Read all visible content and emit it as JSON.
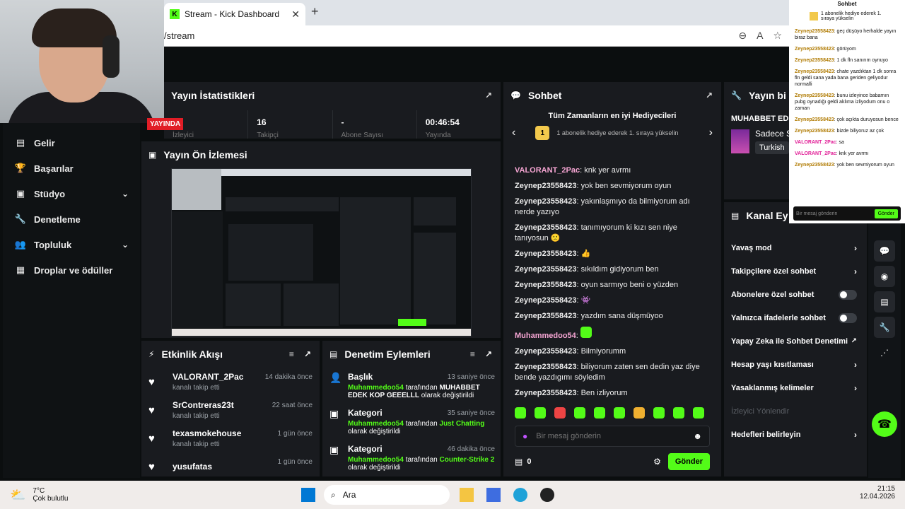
{
  "browser": {
    "tab_title": "Stream - Kick Dashboard",
    "address": "/stream",
    "new_tab": "+"
  },
  "sidebar": {
    "items": [
      {
        "label": "Gelir",
        "icon": "bar-chart-icon"
      },
      {
        "label": "Başarılar",
        "icon": "trophy-icon"
      },
      {
        "label": "Stüdyo",
        "icon": "studio-icon",
        "expand": true
      },
      {
        "label": "Denetleme",
        "icon": "wrench-icon"
      },
      {
        "label": "Topluluk",
        "icon": "users-icon",
        "expand": true
      },
      {
        "label": "Droplar ve ödüller",
        "icon": "gift-icon"
      }
    ]
  },
  "stats": {
    "title": "Yayın İstatistikleri",
    "live_badge": "YAYINDA",
    "cells": [
      {
        "value": "0",
        "label": "İzleyici"
      },
      {
        "value": "16",
        "label": "Takipçi"
      },
      {
        "value": "-",
        "label": "Abone Sayısı"
      },
      {
        "value": "00:46:54",
        "label": "Yayında"
      }
    ]
  },
  "preview": {
    "title": "Yayın Ön İzlemesi"
  },
  "activity": {
    "title": "Etkinlik Akışı",
    "items": [
      {
        "name": "VALORANT_2Pac",
        "sub": "kanalı takip etti",
        "time": "14 dakika önce"
      },
      {
        "name": "SrContreras23t",
        "sub": "kanalı takip etti",
        "time": "22 saat önce"
      },
      {
        "name": "texasmokehouse",
        "sub": "kanalı takip etti",
        "time": "1 gün önce"
      },
      {
        "name": "yusufatas",
        "sub": "",
        "time": "1 gün önce"
      }
    ]
  },
  "moderation": {
    "title": "Denetim Eylemleri",
    "items": [
      {
        "title": "Başlık",
        "time": "13 saniye önce",
        "user": "Muhammedoo54",
        "mid": "tarafından",
        "value": "MUHABBET EDEK KOP GEEELLL",
        "end": "olarak değiştirildi"
      },
      {
        "title": "Kategori",
        "time": "35 saniye önce",
        "user": "Muhammedoo54",
        "mid": "tarafından",
        "value": "Just Chatting",
        "end": "olarak değiştirildi"
      },
      {
        "title": "Kategori",
        "time": "46 dakika önce",
        "user": "Muhammedoo54",
        "mid": "tarafından",
        "value": "Counter-Strike 2",
        "end": "olarak değiştirildi"
      }
    ]
  },
  "chat": {
    "title": "Sohbet",
    "top_title": "Tüm Zamanların en iyi Hediyecileri",
    "top_rank": "1",
    "top_text": "1 abonelik hediye ederek 1. sıraya yükselin",
    "messages": [
      {
        "user": "VALORANT_2Pac",
        "text": "knk yer avrmı",
        "pink": true
      },
      {
        "user": "Zeynep23558423",
        "text": "yok ben sevmiyorum oyun"
      },
      {
        "user": "Zeynep23558423",
        "text": "yakınlaşmıyo da bilmiyorum adı nerde yazıyo"
      },
      {
        "user": "Zeynep23558423",
        "text": "tanımıyorum ki kızı sen niye tanıyosun 🙁"
      },
      {
        "user": "Zeynep23558423",
        "text": "👍"
      },
      {
        "user": "Zeynep23558423",
        "text": "sıkıldım gidiyorum ben"
      },
      {
        "user": "Zeynep23558423",
        "text": "oyun sarmıyo beni o yüzden"
      },
      {
        "user": "Zeynep23558423",
        "text": "👾"
      },
      {
        "user": "Zeynep23558423",
        "text": "yazdım sana düşmüyoo"
      },
      {
        "user": "Muhammedoo54",
        "text": "",
        "pink": true,
        "emote": true
      },
      {
        "user": "Zeynep23558423",
        "text": "Bilmiyorumm"
      },
      {
        "user": "Zeynep23558423",
        "text": "biliyorum zaten sen dedin yaz diye bende yazdıgımı söyledim"
      },
      {
        "user": "Zeynep23558423",
        "text": "Ben izliyorum"
      }
    ],
    "input_placeholder": "Bir mesaj gönderin",
    "count": "0",
    "send": "Gönder"
  },
  "right_info": {
    "title": "Yayın bi",
    "stream_title": "MUHABBET EDEK",
    "channel_name": "Sadece Sc",
    "language": "Turkish"
  },
  "channel": {
    "title": "Kanal Ey",
    "items": [
      {
        "label": "Yavaş mod",
        "type": "chevron"
      },
      {
        "label": "Takipçilere özel sohbet",
        "type": "chevron"
      },
      {
        "label": "Abonelere özel sohbet",
        "type": "toggle"
      },
      {
        "label": "Yalnızca ifadelerle sohbet",
        "type": "toggle"
      },
      {
        "label": "Yapay Zeka ile Sohbet Denetimi",
        "type": "external"
      },
      {
        "label": "Hesap yaşı kısıtlaması",
        "type": "chevron"
      },
      {
        "label": "Yasaklanmış kelimeler",
        "type": "chevron"
      },
      {
        "label": "İzleyici Yönlendir",
        "type": "disabled"
      },
      {
        "label": "Hedefleri belirleyin",
        "type": "chevron"
      }
    ]
  },
  "popout": {
    "title": "Sohbet",
    "top_text": "1 abonelik hediye ederek 1. sıraya yükselin",
    "messages": [
      {
        "user": "Zeynep23558423",
        "text": "geç düşüyo herhalde yayın biraz bana"
      },
      {
        "user": "Zeynep23558423",
        "text": "görüyom"
      },
      {
        "user": "Zeynep23558423",
        "text": "1 dk fln sanırım oynuyo"
      },
      {
        "user": "Zeynep23558423",
        "text": "chate yazdıktan 1 dk sonra fln geldi sana yada bana geriden geliyodur normalli"
      },
      {
        "user": "Zeynep23558423",
        "text": "bunu izleyince babamın pubg oynadığı geldi aklıma izliyodum onu o zaman"
      },
      {
        "user": "Zeynep23558423",
        "text": "çok açıkta duruyosun bence"
      },
      {
        "user": "Zeynep23558423",
        "text": "bizde biliyoruz az çok"
      },
      {
        "user": "VALORANT_2Pac",
        "text": "sa",
        "pink": true
      },
      {
        "user": "VALORANT_2Pac",
        "text": "knk yer avrmı",
        "pink": true
      },
      {
        "user": "Zeynep23558423",
        "text": "yok ben sevmiyorum oyun"
      }
    ],
    "input_placeholder": "Bir mesaj gönderin",
    "send": "Gönder"
  },
  "taskbar": {
    "temp": "7°C",
    "weather": "Çok bulutlu",
    "search": "Ara",
    "time": "21:15",
    "date": "12.04.2026"
  },
  "colors": {
    "accent": "#53fc18",
    "live": "#e11d26",
    "panel": "#191b1f"
  }
}
